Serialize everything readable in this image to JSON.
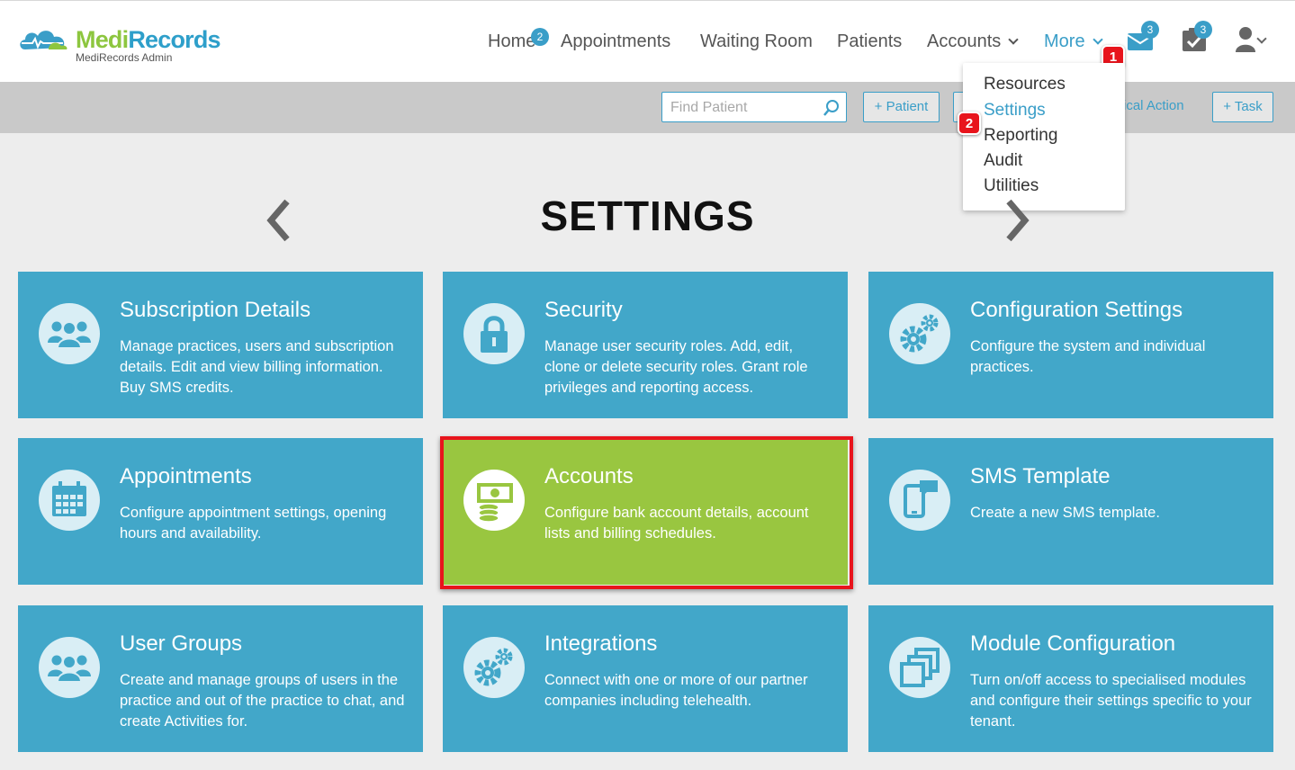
{
  "logo": {
    "name_part1": "Medi",
    "name_part2": "Records",
    "subtitle": "MediRecords Admin"
  },
  "nav": {
    "home": "Home",
    "home_badge": "2",
    "appointments": "Appointments",
    "waiting_room": "Waiting Room",
    "patients": "Patients",
    "accounts": "Accounts",
    "more": "More",
    "messages_badge": "3",
    "tasks_badge": "3"
  },
  "markers": {
    "step1": "1",
    "step2": "2"
  },
  "toolbar": {
    "search_placeholder": "Find Patient",
    "add_patient": "+ Patient",
    "clinical_action": "ical Action",
    "add_task": "+ Task"
  },
  "more_menu": [
    "Resources",
    "Settings",
    "Reporting",
    "Audit",
    "Utilities"
  ],
  "page": {
    "title": "SETTINGS"
  },
  "tiles": [
    {
      "icon": "users-icon",
      "title": "Subscription Details",
      "desc": "Manage practices, users and subscription details. Edit and view billing information. Buy SMS credits."
    },
    {
      "icon": "lock-icon",
      "title": "Security",
      "desc": "Manage user security roles. Add, edit, clone or delete security roles. Grant role privileges and reporting access."
    },
    {
      "icon": "gears-icon",
      "title": "Configuration Settings",
      "desc": "Configure the system and individual practices."
    },
    {
      "icon": "calendar-icon",
      "title": "Appointments",
      "desc": "Configure appointment settings, opening hours and availability."
    },
    {
      "icon": "money-icon",
      "title": "Accounts",
      "desc": "Configure bank account details, account lists and billing schedules."
    },
    {
      "icon": "mobile-chat-icon",
      "title": "SMS Template",
      "desc": "Create a new SMS template."
    },
    {
      "icon": "users-icon",
      "title": "User Groups",
      "desc": "Create and manage groups of users in the practice and out of the practice to chat, and create Activities for."
    },
    {
      "icon": "gears-icon",
      "title": "Integrations",
      "desc": "Connect with one or more of our partner companies including telehealth."
    },
    {
      "icon": "windows-icon",
      "title": "Module Configuration",
      "desc": "Turn on/off access to specialised modules and configure their settings specific to your tenant."
    }
  ],
  "colors": {
    "accent": "#3a9ec8",
    "tile": "#42a7c9",
    "tile_highlight": "#99c640",
    "marker": "#e8141c"
  }
}
